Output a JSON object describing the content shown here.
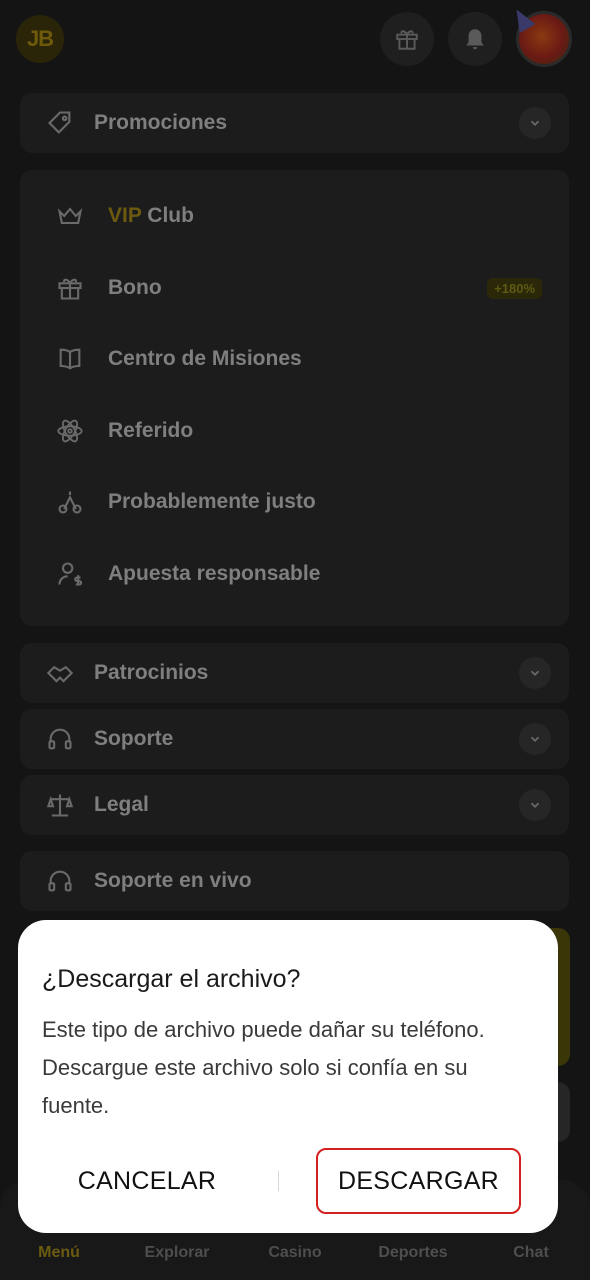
{
  "header": {
    "logo_text": "JB",
    "gift_icon": "gift-icon",
    "bell_icon": "bell-icon",
    "avatar": "user-avatar"
  },
  "menu": {
    "promotions": {
      "label": "Promociones",
      "icon": "tag-icon"
    },
    "group_items": [
      {
        "label_prefix": "VIP",
        "label": " Club",
        "icon": "crown-icon"
      },
      {
        "label": "Bono",
        "badge": "+180%",
        "icon": "gift-icon"
      },
      {
        "label": "Centro de Misiones",
        "icon": "book-icon"
      },
      {
        "label": "Referido",
        "icon": "atom-icon"
      },
      {
        "label": "Probablemente justo",
        "icon": "scale-icon"
      },
      {
        "label": "Apuesta responsable",
        "icon": "user-dollar-icon"
      }
    ],
    "sponsorships": {
      "label": "Patrocinios",
      "icon": "handshake-icon"
    },
    "support": {
      "label": "Soporte",
      "icon": "headset-icon"
    },
    "legal": {
      "label": "Legal",
      "icon": "balance-icon"
    },
    "live_support": {
      "label": "Soporte en vivo",
      "icon": "headset-icon"
    }
  },
  "dialog": {
    "title": "¿Descargar el archivo?",
    "message": "Este tipo de archivo puede dañar su teléfono. Descargue este archivo solo si confía en su fuente.",
    "cancel_label": "CANCELAR",
    "download_label": "DESCARGAR"
  },
  "bottom_nav": {
    "items": [
      {
        "label": "Menú",
        "active": true
      },
      {
        "label": "Explorar"
      },
      {
        "label": "Casino"
      },
      {
        "label": "Deportes"
      },
      {
        "label": "Chat"
      }
    ]
  },
  "colors": {
    "accent": "#6b5a10",
    "danger_outline": "#d32020",
    "background": "#141414"
  }
}
